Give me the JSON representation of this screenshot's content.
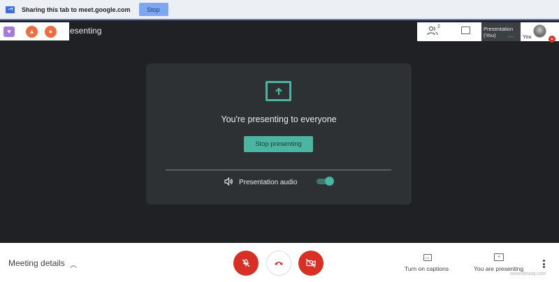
{
  "share_bar": {
    "message": "Sharing this tab to meet.google.com",
    "stop_label": "Stop"
  },
  "header": {
    "title": "esenting"
  },
  "top_right": {
    "participant_count": "2",
    "tile_name": "Presentation (You)",
    "you_label": "You"
  },
  "card": {
    "heading": "You're presenting to everyone",
    "stop_presenting_label": "Stop presenting",
    "audio_label": "Presentation audio",
    "audio_enabled": true,
    "accent_color": "#4ab5a0"
  },
  "bottom": {
    "meeting_details_label": "Meeting details",
    "captions_label": "Turn on captions",
    "presenting_label": "You are presenting",
    "watermark": "www.deuaq.com"
  },
  "colors": {
    "danger": "#d93025",
    "background": "#202124",
    "card": "#2e3134"
  }
}
